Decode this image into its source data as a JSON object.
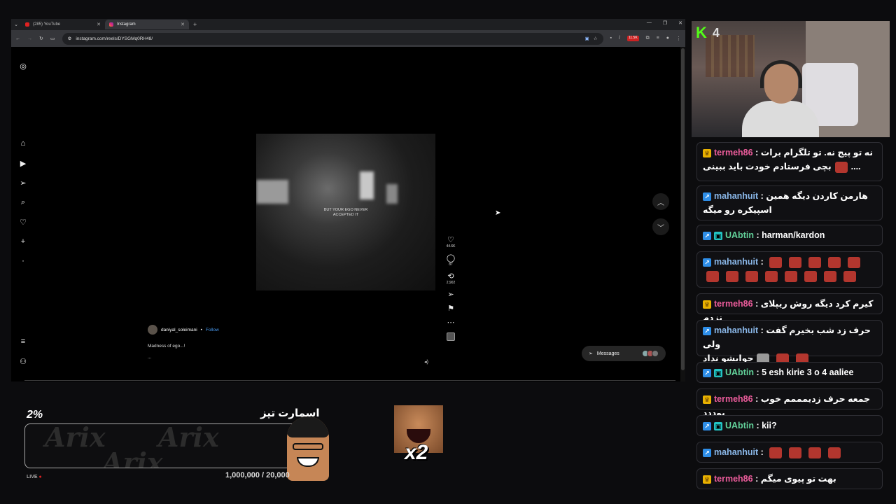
{
  "browser": {
    "tabs": [
      {
        "title": "(285) YouTube",
        "icon": "youtube-icon"
      },
      {
        "title": "Instagram",
        "icon": "instagram-icon"
      }
    ],
    "url": "instagram.com/reels/DYSGMq0RH48/",
    "ext_badge": "11.5K"
  },
  "reel": {
    "caption_overlay": "BUT YOUR EGO NEVER ACCEPTED IT",
    "username": "daniyal_soleimani",
    "follow": "Follow",
    "caption": "Madness of ego...!",
    "more": "...",
    "likes": "44.6K",
    "comments": "87",
    "reposts": "2,902",
    "messages": "Messages"
  },
  "overlay": {
    "percent": "2%",
    "title": "اسمارت تیز",
    "goal": "1,000,000 / 20,000",
    "live": "LIVE",
    "watermark": "Arix",
    "multiplier": "x2"
  },
  "stream": {
    "platform_count": "4"
  },
  "chat": [
    {
      "user": "termeh86",
      "badge": "crown",
      "color": "pink",
      "line1": "نه تو پیج نه. تو تلگرام برات",
      "line2": "بچی فرستادم خودت باید ببینی",
      "suffix": "...."
    },
    {
      "user": "mahanhuit",
      "badge": "blue",
      "color": "lblue",
      "line1": "هارمن کاردن دیگه همین",
      "line2": "اسپیکره رو میگه"
    },
    {
      "user": "UAbtin",
      "badge": "cyan",
      "color": "green",
      "line1": "harman/kardon"
    },
    {
      "user": "mahanhuit",
      "badge": "blue",
      "color": "lblue",
      "line1": "",
      "emotes_line1": 5,
      "emotes_line2": 8
    },
    {
      "user": "termeh86",
      "badge": "crown",
      "color": "pink",
      "line1": "کیرم کرد دیگه روش ریپلای نزدم"
    },
    {
      "user": "mahanhuit",
      "badge": "blue",
      "color": "lblue",
      "line1": "حرف زد شب بخیرم گفت ولی",
      "line2": "جوابشو نداد"
    },
    {
      "user": "UAbtin",
      "badge": "cyan",
      "color": "green",
      "line1": "5 esh kirie 3 o 4 aaliee"
    },
    {
      "user": "termeh86",
      "badge": "crown",
      "color": "pink",
      "line1": "جمعه حرف زدیمممم خوب بوددد"
    },
    {
      "user": "UAbtin",
      "badge": "cyan",
      "color": "green",
      "line1": "kii?"
    },
    {
      "user": "mahanhuit",
      "badge": "blue",
      "color": "lblue",
      "line1": "",
      "emotes_line1": 4
    },
    {
      "user": "termeh86",
      "badge": "crown",
      "color": "pink",
      "line1": "بهت تو پیوی میگم"
    }
  ]
}
